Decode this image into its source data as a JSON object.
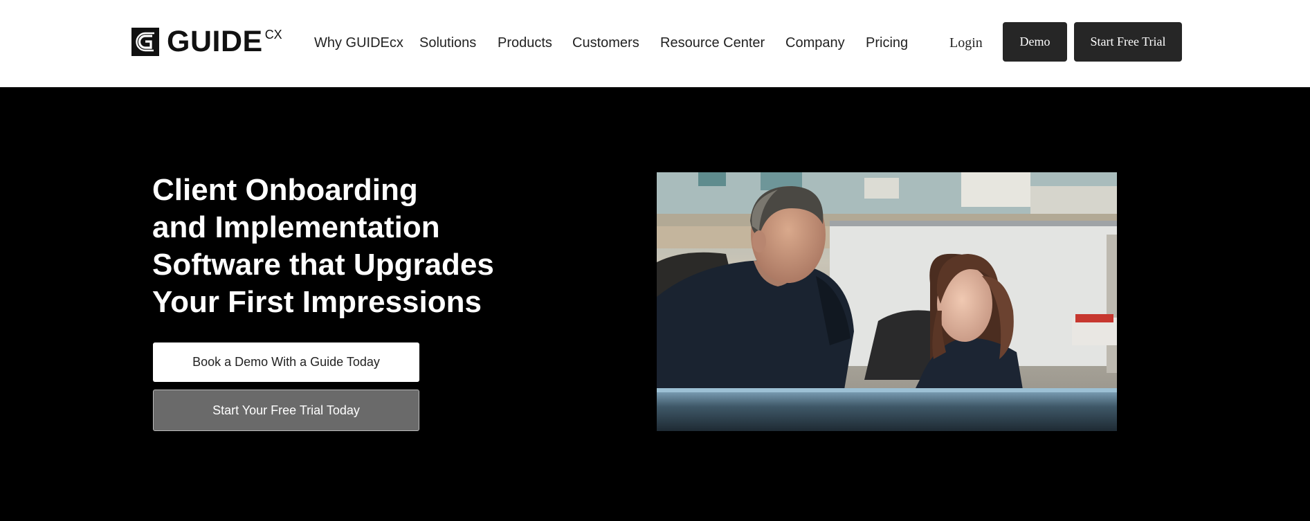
{
  "brand": {
    "name": "GUIDE",
    "superscript": "CX"
  },
  "nav": {
    "items": [
      {
        "label": "Why GUIDEcx"
      },
      {
        "label": "Solutions"
      },
      {
        "label": "Products"
      },
      {
        "label": "Customers"
      },
      {
        "label": "Resource Center"
      },
      {
        "label": "Company"
      },
      {
        "label": "Pricing"
      }
    ],
    "login_label": "Login",
    "demo_label": "Demo",
    "trial_label": "Start Free Trial"
  },
  "hero": {
    "title_lines": [
      "Client Onboarding",
      "and Implementation",
      "Software that Upgrades",
      "Your First Impressions"
    ],
    "primary_cta": "Book a Demo With a Guide Today",
    "secondary_cta": "Start Your Free Trial Today"
  },
  "colors": {
    "header_bg": "#ffffff",
    "hero_bg": "#000000",
    "button_dark": "#262626",
    "cta_secondary_bg": "#6a6a6a"
  }
}
